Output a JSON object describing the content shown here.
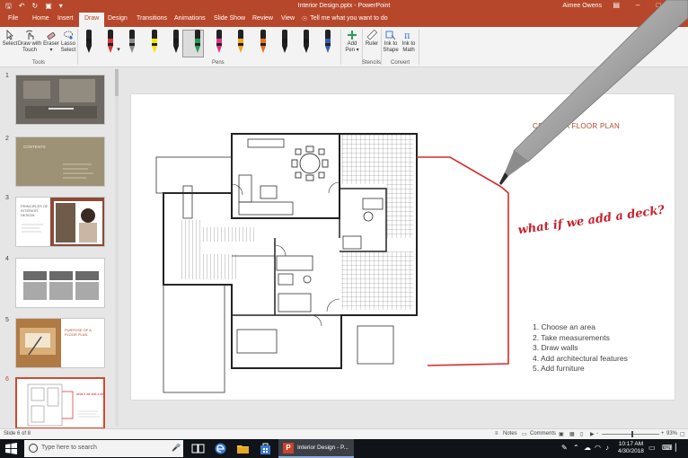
{
  "titlebar": {
    "document_title": "Interior Design.pptx  -  PowerPoint",
    "user_name": "Aimee Owens",
    "qat_icons": [
      "save-icon",
      "undo-icon",
      "redo-icon",
      "start-from-beginning-icon",
      "customize-qat-icon"
    ]
  },
  "tabs": [
    {
      "label": "File"
    },
    {
      "label": "Home"
    },
    {
      "label": "Insert"
    },
    {
      "label": "Draw",
      "active": true
    },
    {
      "label": "Design"
    },
    {
      "label": "Transitions"
    },
    {
      "label": "Animations"
    },
    {
      "label": "Slide Show"
    },
    {
      "label": "Review"
    },
    {
      "label": "View"
    }
  ],
  "tell_me": {
    "placeholder": "Tell me what you want to do"
  },
  "ribbon": {
    "tools": {
      "select": "Select",
      "draw_with_touch_1": "Draw with",
      "draw_with_touch_2": "Touch",
      "eraser": "Eraser",
      "lasso_1": "Lasso",
      "lasso_2": "Select",
      "group_label": "Tools"
    },
    "pens": {
      "group_label": "Pens",
      "colors": [
        "#1a1a1a",
        "#d8383a",
        "#8c8c8c",
        "#f2e600",
        "#1a1a1a",
        "#2a9a57",
        "#e0378b",
        "#f0a51c",
        "#e8701c",
        "#1a1a1a",
        "#1a1a1a",
        "#3a5bb5"
      ],
      "selected_index": 1
    },
    "add_pen": {
      "line1": "Add",
      "line2": "Pen"
    },
    "stencils": {
      "ruler": "Ruler",
      "group_label": "Stencils"
    },
    "convert": {
      "ink_to_shape_1": "Ink to",
      "ink_to_shape_2": "Shape",
      "ink_to_math_1": "Ink to",
      "ink_to_math_2": "Math",
      "group_label": "Convert"
    }
  },
  "thumbnails": [
    {
      "number": "1"
    },
    {
      "number": "2",
      "text": "CONTENTS"
    },
    {
      "number": "3",
      "text": "PRINCIPLES OF INTERIOR DESIGN"
    },
    {
      "number": "4"
    },
    {
      "number": "5",
      "text": "PURPOSE OF A FLOOR PLAN"
    },
    {
      "number": "6",
      "selected": true
    }
  ],
  "slide": {
    "title": "CREATE A FLOOR PLAN",
    "handwritten_note": "what if we add a deck?",
    "steps": [
      "1. Choose an area",
      "2. Take measurements",
      "3. Draw walls",
      "4. Add architectural features",
      "5. Add furniture"
    ],
    "ink_color": "#d62b2b"
  },
  "statusbar": {
    "slide_counter": "Slide 6 of 8",
    "notes": "Notes",
    "comments": "Comments",
    "zoom": "93%",
    "zoom_minus": "-",
    "zoom_plus": "+"
  },
  "taskbar": {
    "search_placeholder": "Type here to search",
    "active_app_label": "Interior Design - P...",
    "time": "10:17 AM",
    "date": "4/30/2018"
  }
}
